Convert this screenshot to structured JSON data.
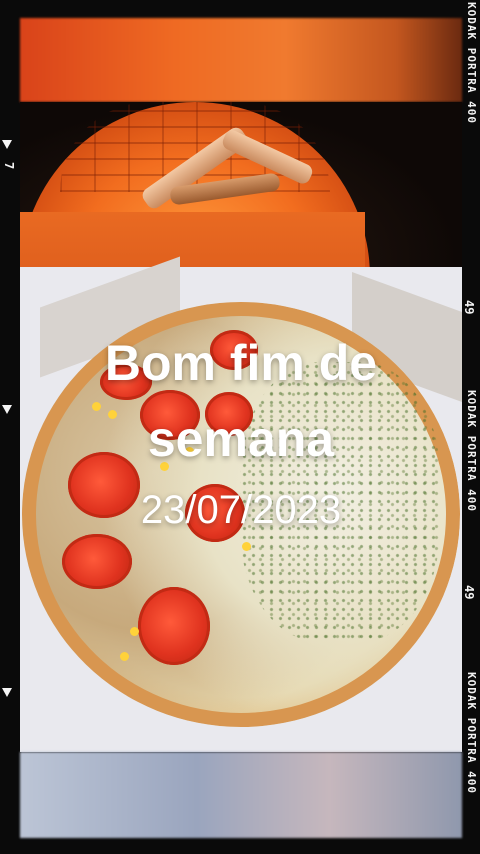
{
  "overlay": {
    "title": "Bom fim de semana",
    "date": "23/07/2023"
  },
  "film_edge": {
    "brand_1": "KODAK PORTRA 400",
    "brand_2": "KODAK PORTRA 400",
    "brand_3": "KODAK PORTRA 400",
    "frame_num_1": "49",
    "frame_num_2": "49",
    "left_num": "7"
  },
  "colors": {
    "oven_fire": "#f26d1f",
    "film_border": "#0a0a0a",
    "text": "#ffffff"
  }
}
